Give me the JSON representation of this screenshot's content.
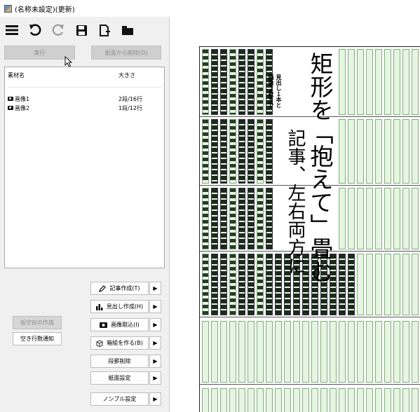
{
  "window": {
    "title": "(名称未設定)(更新)"
  },
  "toolbar": {
    "icons": [
      "menu-icon",
      "undo-icon",
      "redo-icon",
      "save-icon",
      "new-page-icon",
      "folder-icon"
    ]
  },
  "actions": {
    "execute_label": "実行",
    "remove_label": "紙面から削除(D)"
  },
  "materials": {
    "col_name": "素材名",
    "col_size": "大きさ",
    "rows": [
      {
        "name": "画像1",
        "size": "2段/16行"
      },
      {
        "name": "画像2",
        "size": "1段/12行"
      }
    ]
  },
  "commands": {
    "article": "記事作成(T)",
    "headline": "見出し作成(H)",
    "image": "画像取込(I)",
    "box": "箱組を作る(B)",
    "delete_dan": "段罫削除",
    "paper_settings": "紙面設定",
    "nombre_settings": "ノンブル設定"
  },
  "side_buttons": {
    "temp_blank": "仮空白の作成",
    "blank_lines": "空き行数通知"
  },
  "preview": {
    "headline_main": "矩形を「抱えて」畳む",
    "headline_line2": "記事、左右両方に",
    "subhead": "見出し１本と",
    "subhead2": "画像２枚まで"
  },
  "colors": {
    "column_fill": "#e6f5e2",
    "column_border": "#7fae7a",
    "disabled_button": "#cfcfcf"
  }
}
